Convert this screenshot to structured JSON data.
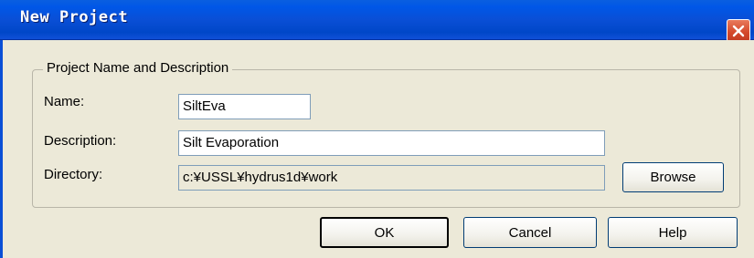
{
  "window": {
    "title": "New Project",
    "close_icon": "close-icon"
  },
  "group": {
    "title": "Project Name and Description"
  },
  "fields": {
    "name": {
      "label": "Name:",
      "value": "SiltEva"
    },
    "description": {
      "label": "Description:",
      "value": "Silt Evaporation"
    },
    "directory": {
      "label": "Directory:",
      "value": "c:¥USSL¥hydrus1d¥work"
    }
  },
  "buttons": {
    "browse": "Browse",
    "ok": "OK",
    "cancel": "Cancel",
    "help": "Help"
  },
  "colors": {
    "titlebar": "#0a4fd6",
    "close": "#d4482a",
    "face": "#ece9d8"
  }
}
